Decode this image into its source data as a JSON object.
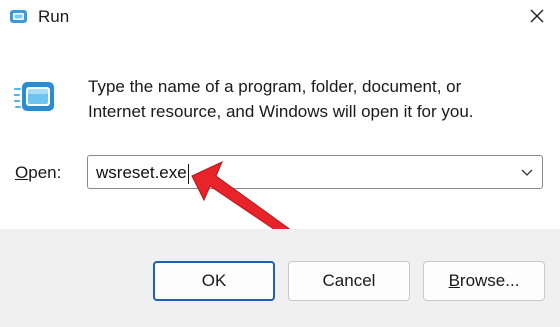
{
  "window": {
    "title": "Run",
    "close_icon": "close-icon"
  },
  "description": {
    "line1": "Type the name of a program, folder, document, or",
    "line2": "Internet resource, and Windows will open it for you."
  },
  "open": {
    "label_access": "O",
    "label_rest": "pen:",
    "value": "wsreset.exe",
    "dropdown_icon": "chevron-down-icon"
  },
  "buttons": {
    "ok": "OK",
    "cancel": "Cancel",
    "browse_access": "B",
    "browse_rest": "rowse..."
  },
  "colors": {
    "accent": "#1f5fb5",
    "arrow": "#e8232a",
    "footer_bg": "#f0f0f0"
  }
}
